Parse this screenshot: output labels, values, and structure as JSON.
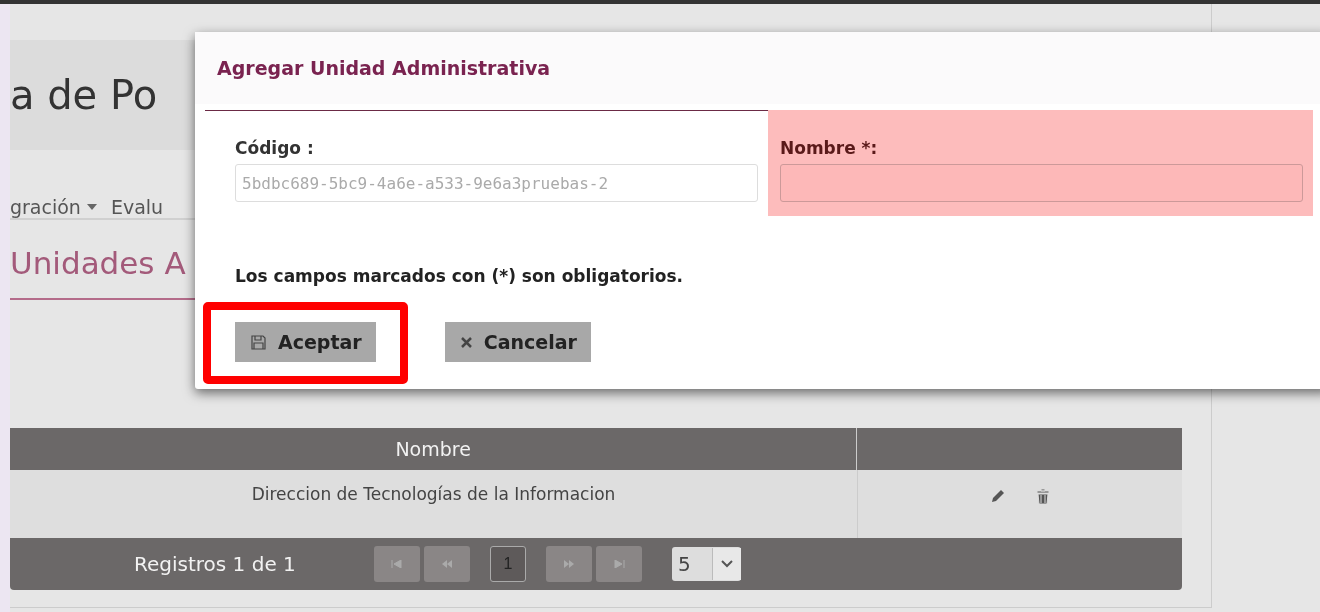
{
  "page_title": "a de Po",
  "nav": [
    {
      "label": "gración",
      "dropdown": true
    },
    {
      "label": "Evalu",
      "dropdown": false
    }
  ],
  "section_title": "Unidades A",
  "table": {
    "columns": [
      "Nombre"
    ],
    "rows": [
      {
        "nombre": "Direccion de Tecnologías de la Informacion",
        "actions": [
          {
            "kind": "edit"
          },
          {
            "kind": "delete"
          }
        ]
      }
    ],
    "records": "Registros 1 de 1",
    "pager": [
      {
        "kind": "first",
        "disabled": true
      },
      {
        "kind": "prev",
        "disabled": true
      },
      {
        "kind": "page",
        "label": "1",
        "selected": true
      },
      {
        "kind": "next",
        "disabled": true
      },
      {
        "kind": "last",
        "disabled": true
      }
    ],
    "page_size": "5"
  },
  "dialog": {
    "title": "Agregar Unidad Administrativa",
    "fields": [
      {
        "label": "Código :",
        "value": "5bdbc689-5bc9-4a6e-a533-9e6a3pruebas-2",
        "disabled": true,
        "highlighted": false
      },
      {
        "label": "Nombre *:",
        "disabled": false,
        "highlighted": true
      }
    ],
    "note": "Los campos marcados con (*) son obligatorios.",
    "buttons": [
      {
        "kind": "save",
        "label": "Aceptar",
        "highlighted": true
      },
      {
        "kind": "cancel",
        "label": "Cancelar",
        "highlighted": false
      }
    ]
  }
}
